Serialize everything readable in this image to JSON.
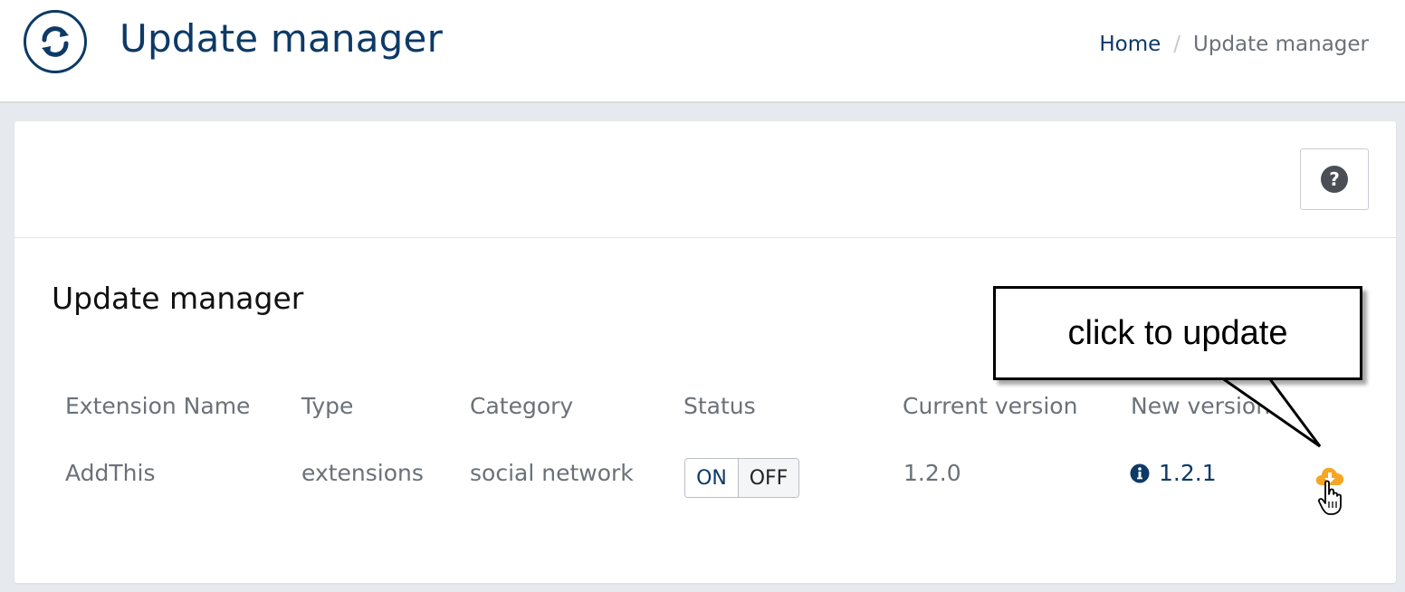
{
  "header": {
    "title": "Update manager",
    "breadcrumb": {
      "home": "Home",
      "separator": "/",
      "current": "Update manager"
    }
  },
  "panel": {
    "section_title": "Update manager",
    "columns": [
      "Extension Name",
      "Type",
      "Category",
      "Status",
      "Current version",
      "New version"
    ],
    "rows": [
      {
        "name": "AddThis",
        "type": "extensions",
        "category": "social network",
        "status_on": "ON",
        "status_off": "OFF",
        "current_version": "1.2.0",
        "new_version": "1.2.1"
      }
    ]
  },
  "callout": {
    "text": "click to update"
  },
  "colors": {
    "brand": "#0d3a66",
    "accent_orange": "#f5a623",
    "muted": "#6b7178"
  },
  "icons": {
    "app": "refresh-icon",
    "help": "question-circle-icon",
    "info": "info-circle-icon",
    "update": "cloud-download-icon",
    "cursor": "hand-pointer-icon"
  }
}
